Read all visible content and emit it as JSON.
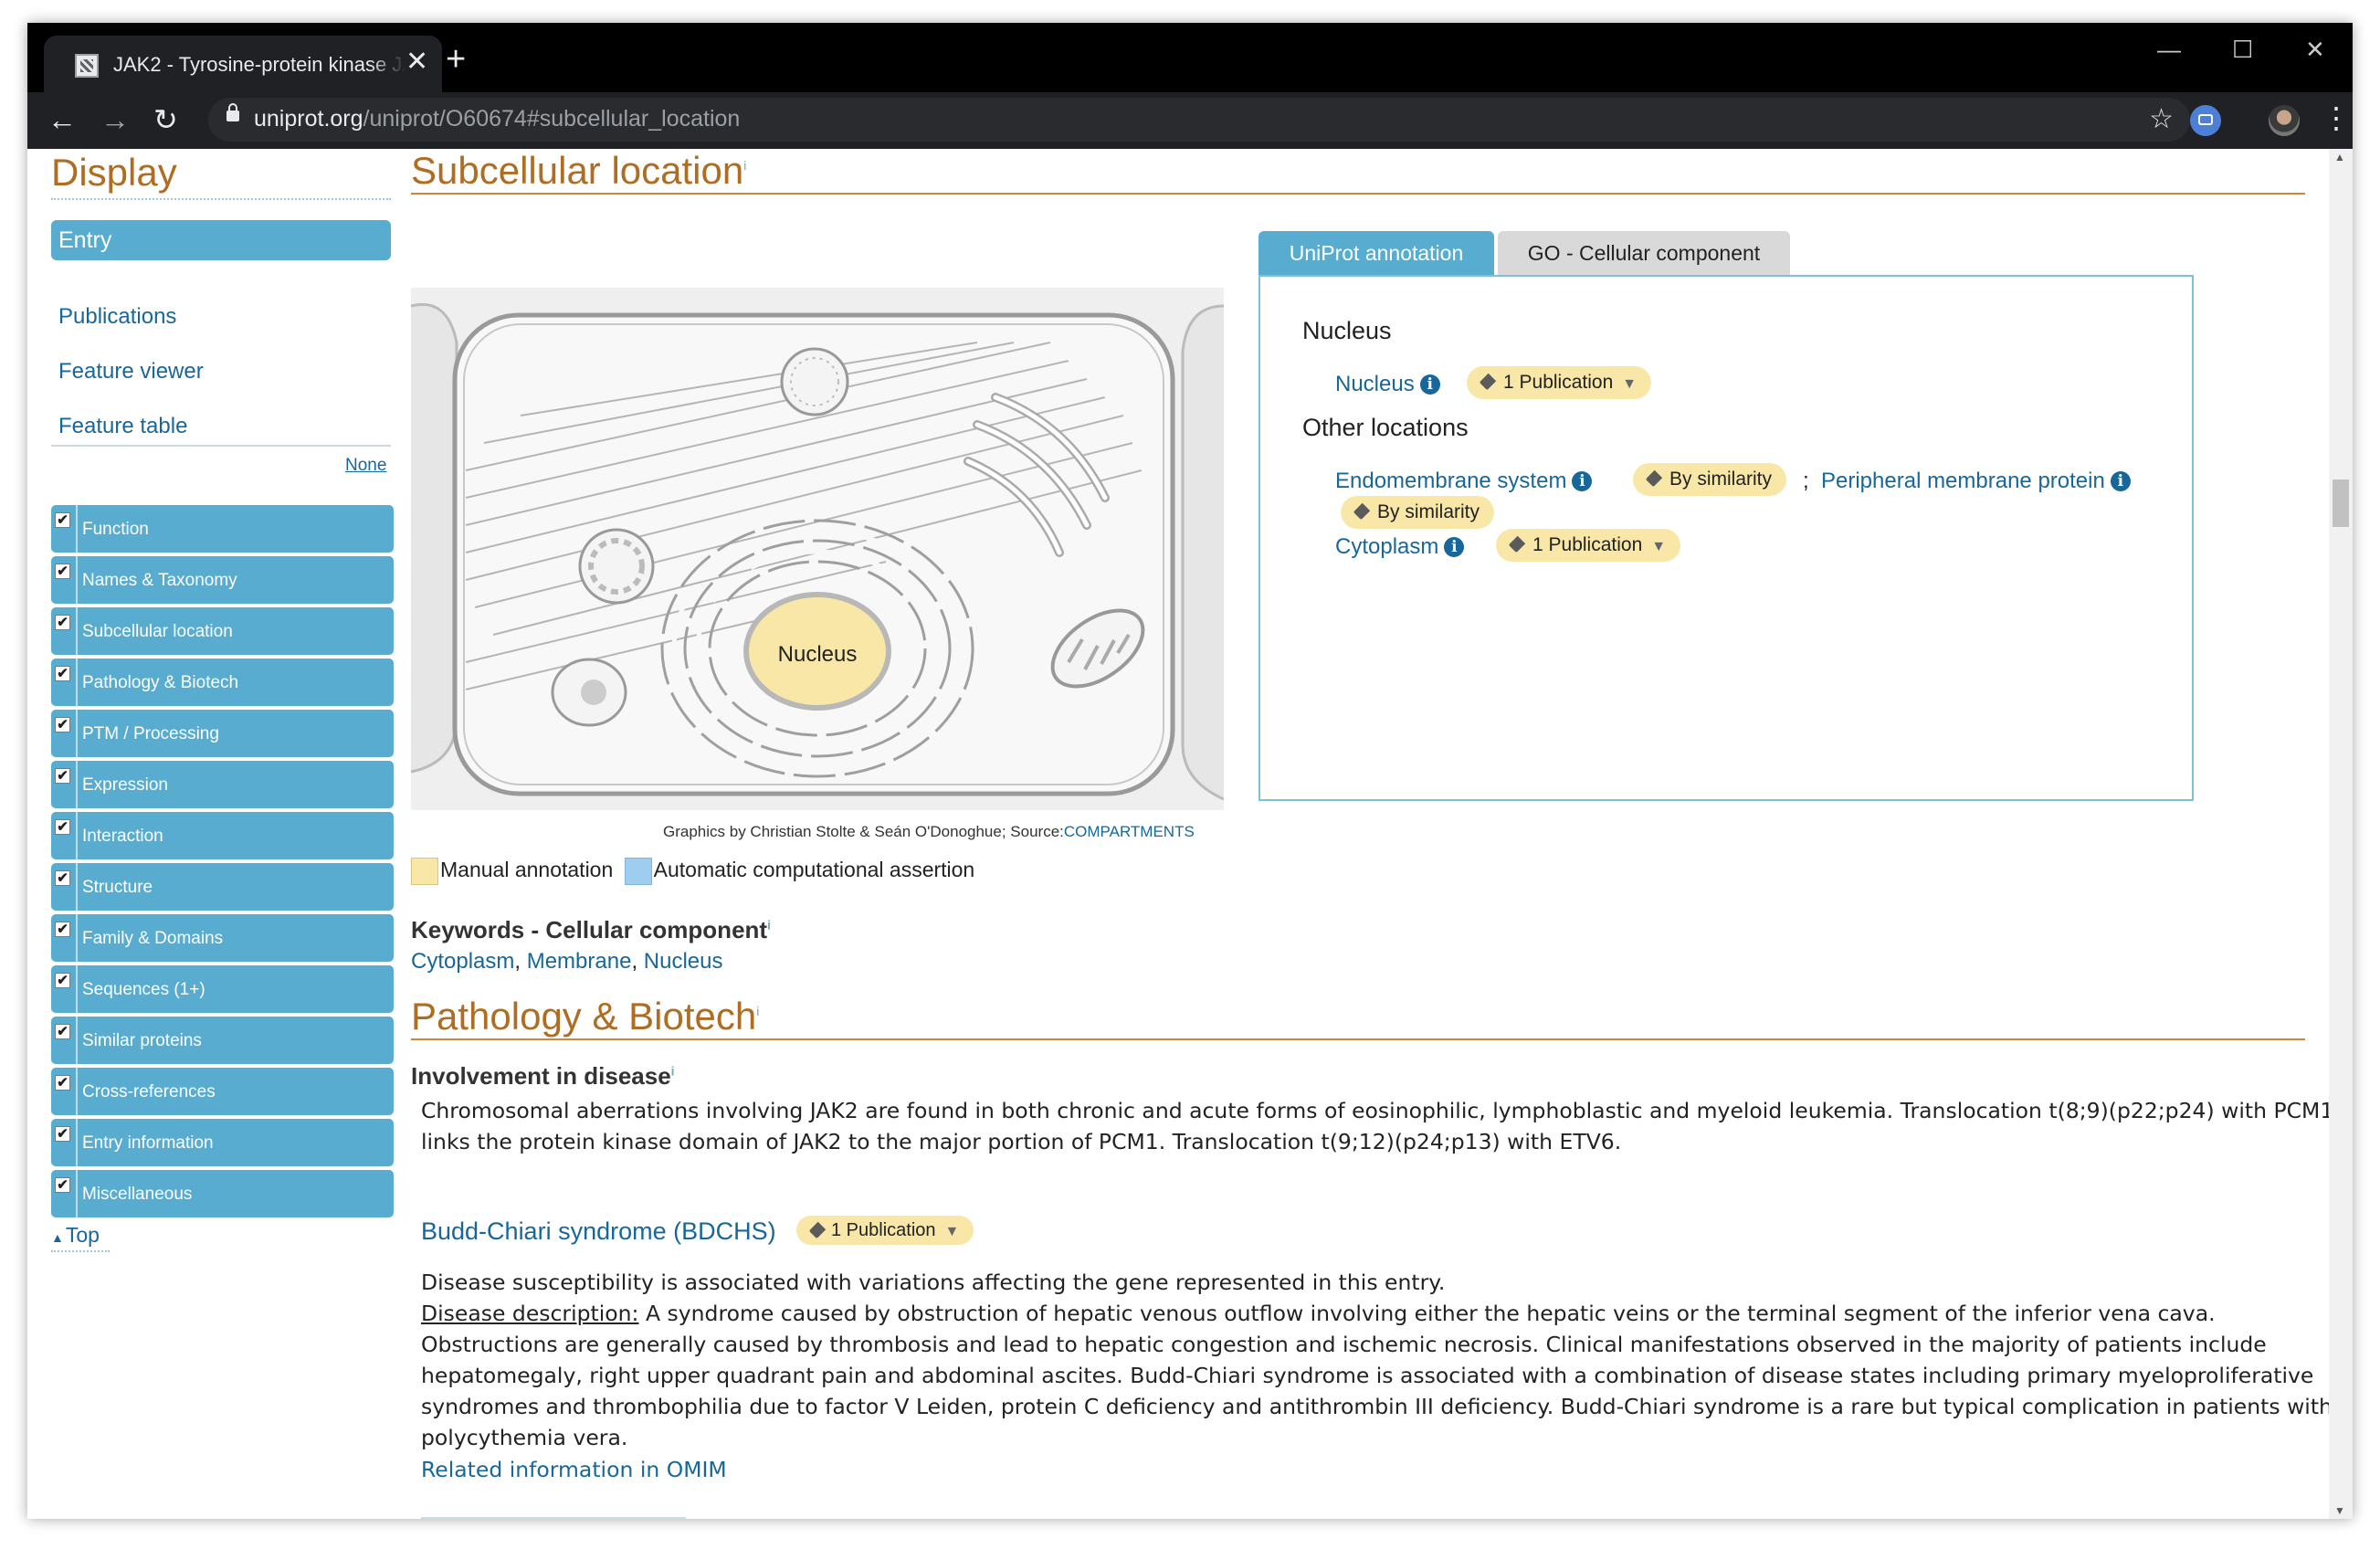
{
  "browser": {
    "tab_title": "JAK2 - Tyrosine-protein kinase JAK2",
    "tab_close": "✕",
    "new_tab": "+",
    "url_host": "uniprot.org",
    "url_path": "/uniprot/O60674#subcellular_location",
    "window_controls": {
      "minimize": "—",
      "maximize": "☐",
      "close": "✕"
    },
    "nav": {
      "back": "←",
      "forward": "→",
      "reload": "↻"
    }
  },
  "sidebar": {
    "title": "Display",
    "entry": "Entry",
    "links": [
      "Publications",
      "Feature viewer",
      "Feature table"
    ],
    "none_link": "None",
    "sections": [
      "Function",
      "Names & Taxonomy",
      "Subcellular location",
      "Pathology & Biotech",
      "PTM / Processing",
      "Expression",
      "Interaction",
      "Structure",
      "Family & Domains",
      "Sequences (1+)",
      "Similar proteins",
      "Cross-references",
      "Entry information",
      "Miscellaneous"
    ],
    "checkmark": "✔",
    "top_link": "Top"
  },
  "subcellular": {
    "title": "Subcellular location",
    "info_mark": "i",
    "cell_label": "Nucleus",
    "credit_text": "Graphics by Christian Stolte & Seán O'Donoghue; Source:",
    "credit_source": "COMPARTMENTS",
    "legend_manual": "Manual annotation",
    "legend_auto": "Automatic computational assertion",
    "legend_manual_color": "#f9e7a8",
    "legend_auto_color": "#9ecdf0",
    "tab_uniprot": "UniProt annotation",
    "tab_go": "GO - Cellular component",
    "nucleus_heading": "Nucleus",
    "nucleus_link": "Nucleus",
    "nucleus_evidence": "1 Publication",
    "other_heading": "Other locations",
    "endomembrane_link": "Endomembrane system",
    "endomembrane_evidence": "By similarity",
    "peripheral_link": "Peripheral membrane protein",
    "peripheral_evidence": "By similarity",
    "cytoplasm_link": "Cytoplasm",
    "cytoplasm_evidence": "1 Publication",
    "keywords_title": "Keywords - Cellular component",
    "keywords": [
      "Cytoplasm",
      "Membrane",
      "Nucleus"
    ]
  },
  "pathology": {
    "title": "Pathology & Biotech",
    "involvement_title": "Involvement in disease",
    "involvement_text_1": "Chromosomal aberrations involving JAK2 are found in both chronic and acute forms of eosinophilic, lymphoblastic and myeloid leukemia. Translocation t(8;9)(p22;p24) with PCM1",
    "involvement_text_2": "links the protein kinase domain of JAK2 to the major portion of PCM1. Translocation t(9;12)(p24;p13) with ETV6.",
    "disease_name": "Budd-Chiari syndrome (BDCHS)",
    "disease_evidence": "1 Publication",
    "disease_note": "Disease susceptibility is associated with variations affecting the gene represented in this entry.",
    "description_label": "Disease description:",
    "description_lines": [
      " A syndrome caused by obstruction of hepatic venous outflow involving either the hepatic veins or the terminal segment of the inferior vena cava.",
      "Obstructions are generally caused by thrombosis and lead to hepatic congestion and ischemic necrosis. Clinical manifestations observed in the majority of patients include",
      "hepatomegaly, right upper quadrant pain and abdominal ascites. Budd-Chiari syndrome is associated with a combination of disease states including primary myeloproliferative",
      "syndromes and thrombophilia due to factor V Leiden, protein C deficiency and antithrombin III deficiency. Budd-Chiari syndrome is a rare but typical complication in patients with",
      "polycythemia vera."
    ],
    "omim_link": "Related information in OMIM"
  },
  "colors": {
    "accent_orange": "#ae6d22",
    "accent_blue": "#58acd0",
    "link": "#17679a",
    "evidence_pill": "#f9e7a8"
  }
}
